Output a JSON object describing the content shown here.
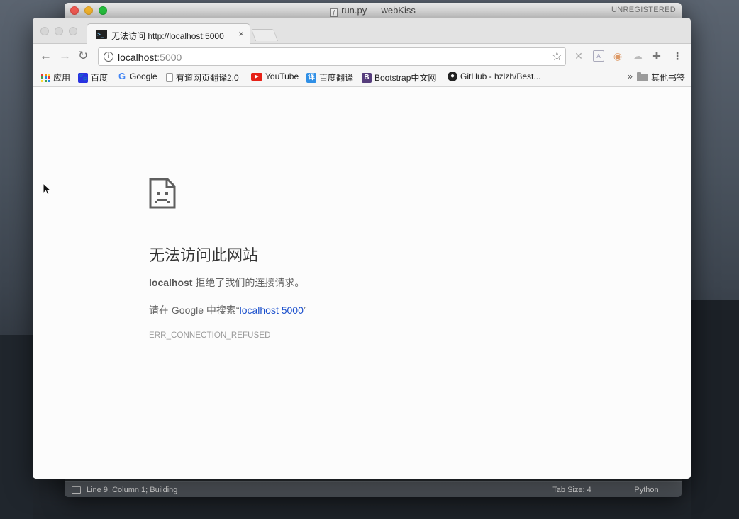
{
  "editor": {
    "title": "run.py — webKiss",
    "registration": "UNREGISTERED",
    "status": "Line 9, Column 1; Building",
    "tab_size": "Tab Size: 4",
    "syntax": "Python"
  },
  "browser": {
    "tab_title": "无法访问 http://localhost:5000",
    "tab_close": "×",
    "url_host": "localhost",
    "url_port": ":5000",
    "bookmarks": [
      {
        "label": "应用",
        "icon": "apps-grid-icon"
      },
      {
        "label": "百度",
        "icon": "baidu-icon"
      },
      {
        "label": "Google",
        "icon": "google-icon"
      },
      {
        "label": "有道网页翻译2.0",
        "icon": "page-icon"
      },
      {
        "label": "YouTube",
        "icon": "youtube-icon"
      },
      {
        "label": "百度翻译",
        "icon": "baidu-translate-icon"
      },
      {
        "label": "Bootstrap中文网",
        "icon": "bootstrap-icon"
      },
      {
        "label": "GitHub - hzlzh/Best...",
        "icon": "github-icon"
      }
    ],
    "bookmarks_more": "»",
    "other_bookmarks": "其他书签"
  },
  "error_page": {
    "title": "无法访问此网站",
    "host": "localhost",
    "desc_suffix": " 拒绝了我们的连接请求。",
    "search_prefix": "请在 Google 中搜索“",
    "search_link": "localhost 5000",
    "search_suffix": "”",
    "code": "ERR_CONNECTION_REFUSED"
  },
  "colors": {
    "link": "#1a4fcc",
    "youtube": "#e62117",
    "baidu": "#2932e1",
    "bootstrap": "#563d7c"
  }
}
